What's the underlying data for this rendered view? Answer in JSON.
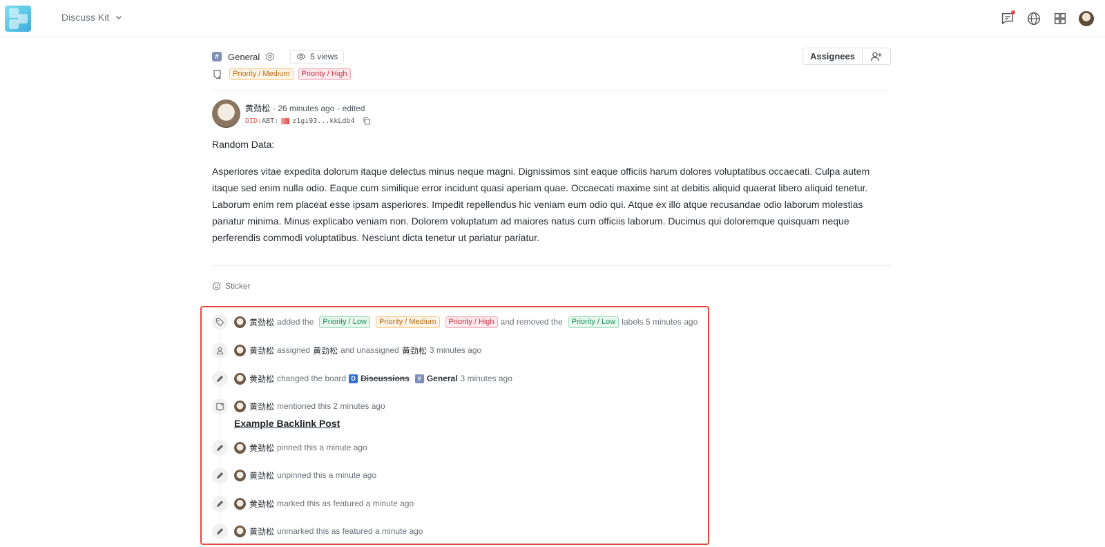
{
  "header": {
    "app_name": "Discuss Kit",
    "icons": [
      "chat-icon",
      "globe-icon",
      "apps-grid-icon",
      "user-avatar"
    ]
  },
  "post": {
    "board": "General",
    "views": "5 views",
    "assignees_label": "Assignees",
    "labels": [
      "Priority / Medium",
      "Priority / High"
    ],
    "author": {
      "name": "黄劲松",
      "time": "· 26 minutes ago",
      "edited": "· edited",
      "did_prefix": "DID",
      "did_mid": ":ABT:",
      "did_value": "z1gi93...kkLdb4"
    },
    "title": "Random Data:",
    "body": "Asperiores vitae expedita dolorum itaque delectus minus neque magni. Dignissimos sint eaque officiis harum dolores voluptatibus occaecati. Culpa autem itaque sed enim nulla odio. Eaque cum similique error incidunt quasi aperiam quae. Occaecati maxime sint at debitis aliquid quaerat libero aliquid tenetur. Laborum enim rem placeat esse ipsam asperiores. Impedit repellendus hic veniam eum odio qui. Atque ex illo atque recusandae odio laborum molestias pariatur minima. Minus explicabo veniam non. Dolorem voluptatum ad maiores natus cum officiis laborum. Ducimus qui doloremque quisquam neque perferendis commodi voluptatibus. Nesciunt dicta tenetur ut pariatur pariatur.",
    "sticker_label": "Sticker"
  },
  "timeline": {
    "user": "黄劲松",
    "events": {
      "labels": {
        "added": "added the",
        "added_labels": [
          "Priority / Low",
          "Priority / Medium",
          "Priority / High"
        ],
        "removed": "and removed the",
        "removed_label": "Priority / Low",
        "suffix": "labels 5 minutes ago"
      },
      "assign": {
        "t1": "assigned",
        "t2": "and unassigned",
        "time": "3 minutes ago"
      },
      "board": {
        "t1": "changed the board",
        "from": "Discussions",
        "to": "General",
        "time": "3 minutes ago"
      },
      "mention": {
        "text": "mentioned this 2 minutes ago",
        "link": "Example Backlink Post"
      },
      "pinned": "pinned this a minute ago",
      "unpinned": "unpinned this a minute ago",
      "featured": "marked this as featured a minute ago",
      "unfeatured": "unmarked this as featured a minute ago"
    }
  }
}
